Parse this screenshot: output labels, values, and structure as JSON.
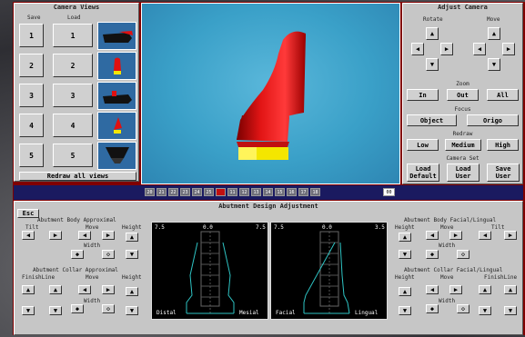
{
  "camera_views": {
    "title": "Camera Views",
    "save_label": "Save",
    "load_label": "Load",
    "slots": [
      "1",
      "2",
      "3",
      "4",
      "5"
    ],
    "redraw": "Redraw all views"
  },
  "adjust_camera": {
    "title": "Adjust Camera",
    "rotate": "Rotate",
    "move": "Move",
    "zoom": "Zoom",
    "zoom_buttons": [
      "In",
      "Out",
      "All"
    ],
    "focus": "Focus",
    "focus_buttons": [
      "Object",
      "Origo"
    ],
    "redraw": "Redraw",
    "redraw_buttons": [
      "Low",
      "Medium",
      "High"
    ],
    "camera_set": "Camera Set",
    "set_buttons": [
      [
        "Load",
        "Default"
      ],
      [
        "Load",
        "User"
      ],
      [
        "Save",
        "User"
      ]
    ]
  },
  "timeline": {
    "frames": [
      "20",
      "21",
      "22",
      "23",
      "24",
      "25",
      "",
      "11",
      "12",
      "13",
      "14",
      "15",
      "16",
      "17",
      "18"
    ],
    "end": "00"
  },
  "abutment": {
    "title": "Abutment Design Adjustment",
    "esc": "Esc",
    "left_body": "Abutment Body Approximal",
    "left_collar": "Abutment Collar Approximal",
    "right_body": "Abutment Body Facial/Lingual",
    "right_collar": "Abutment Collar Facial/Lingual",
    "tilt": "Tilt",
    "move": "Move",
    "height": "Height",
    "width": "Width",
    "finishline": "FinishLine",
    "graph_left": {
      "left_val": "7.5",
      "mid_val": "0.0",
      "right_val": "7.5",
      "left_label": "Distal",
      "right_label": "Mesial"
    },
    "graph_right": {
      "left_val": "7.5",
      "mid_val": "0.0",
      "right_val": "3.5",
      "left_label": "Facial",
      "right_label": "Lingual"
    }
  },
  "colors": {
    "frame": "#800000",
    "panel": "#c6c6c6",
    "viewport": "#3fa3c9",
    "model": "#e01010",
    "collar": "#f4e600"
  }
}
